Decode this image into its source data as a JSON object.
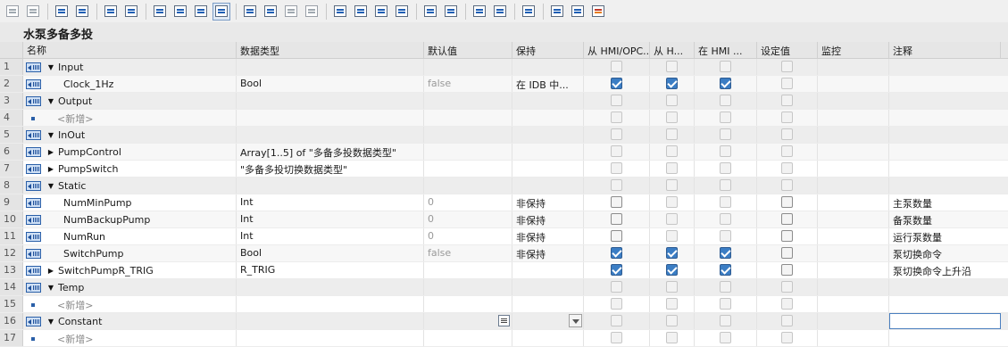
{
  "toolbar": {
    "buttons": [
      "insert-row-icon",
      "add-row-icon",
      "expand-icon",
      "download-icon",
      "compare-icon",
      "monitor-all-icon",
      "collapse-icon",
      "list-icon",
      "download-arrow-icon",
      "settings-selected-icon",
      "insert-var-icon",
      "delete-var-icon",
      "network-icon",
      "list-down-icon",
      "arrow-left-icon",
      "indent-icon",
      "outdent-icon",
      "align-icon",
      "branch-icon",
      "filter-icon",
      "undo-icon",
      "redo-icon",
      "lock-icon",
      "play-icon",
      "play-alt-icon",
      "stop-icon"
    ]
  },
  "block": {
    "title": "水泵多备多投"
  },
  "columns": {
    "name": "名称",
    "type": "数据类型",
    "default": "默认值",
    "retain": "保持",
    "hmi_opc": "从 HMI/OPC...",
    "from_h": "从 H...",
    "in_hmi": "在 HMI ...",
    "setpoint": "设定值",
    "monitor": "监控",
    "comment": "注释"
  },
  "rows": [
    {
      "n": "1",
      "name": "Input",
      "indent": 0,
      "expand": "down",
      "icon": "if",
      "type": "",
      "def": "",
      "ret": "",
      "hmi": "dis",
      "from": "dis",
      "in": "dis",
      "set": "dis",
      "cmt": ""
    },
    {
      "n": "2",
      "name": "Clock_1Hz",
      "indent": 1,
      "expand": "none",
      "icon": "if",
      "type": "Bool",
      "def": "false",
      "ret": "在 IDB 中...",
      "hmi": "chk",
      "from": "chk",
      "in": "chk",
      "set": "dis",
      "cmt": ""
    },
    {
      "n": "3",
      "name": "Output",
      "indent": 0,
      "expand": "down",
      "icon": "if",
      "type": "",
      "def": "",
      "ret": "",
      "hmi": "dis",
      "from": "dis",
      "in": "dis",
      "set": "dis",
      "cmt": ""
    },
    {
      "n": "4",
      "name": "<新增>",
      "indent": 1,
      "expand": "none",
      "icon": "sq",
      "type": "",
      "def": "",
      "ret": "",
      "hmi": "dis",
      "from": "dis",
      "in": "dis",
      "set": "dis",
      "cmt": "",
      "add": true
    },
    {
      "n": "5",
      "name": "InOut",
      "indent": 0,
      "expand": "down",
      "icon": "if",
      "type": "",
      "def": "",
      "ret": "",
      "hmi": "dis",
      "from": "dis",
      "in": "dis",
      "set": "dis",
      "cmt": ""
    },
    {
      "n": "6",
      "name": "PumpControl",
      "indent": 0,
      "expand": "right",
      "icon": "if",
      "type": "Array[1..5] of \"多备多投数据类型\"",
      "def": "",
      "ret": "",
      "hmi": "dis",
      "from": "dis",
      "in": "dis",
      "set": "dis",
      "cmt": ""
    },
    {
      "n": "7",
      "name": "PumpSwitch",
      "indent": 0,
      "expand": "right",
      "icon": "if",
      "type": "\"多备多投切换数据类型\"",
      "def": "",
      "ret": "",
      "hmi": "dis",
      "from": "dis",
      "in": "dis",
      "set": "dis",
      "cmt": ""
    },
    {
      "n": "8",
      "name": "Static",
      "indent": 0,
      "expand": "down",
      "icon": "if",
      "type": "",
      "def": "",
      "ret": "",
      "hmi": "dis",
      "from": "dis",
      "in": "dis",
      "set": "dis",
      "cmt": ""
    },
    {
      "n": "9",
      "name": "NumMinPump",
      "indent": 1,
      "expand": "none",
      "icon": "if",
      "type": "Int",
      "def": "0",
      "ret": "非保持",
      "hmi": "en",
      "from": "dis",
      "in": "dis",
      "set": "en",
      "cmt": "主泵数量"
    },
    {
      "n": "10",
      "name": "NumBackupPump",
      "indent": 1,
      "expand": "none",
      "icon": "if",
      "type": "Int",
      "def": "0",
      "ret": "非保持",
      "hmi": "en",
      "from": "dis",
      "in": "dis",
      "set": "en",
      "cmt": "备泵数量"
    },
    {
      "n": "11",
      "name": "NumRun",
      "indent": 1,
      "expand": "none",
      "icon": "if",
      "type": "Int",
      "def": "0",
      "ret": "非保持",
      "hmi": "en",
      "from": "dis",
      "in": "dis",
      "set": "en",
      "cmt": "运行泵数量"
    },
    {
      "n": "12",
      "name": "SwitchPump",
      "indent": 1,
      "expand": "none",
      "icon": "if",
      "type": "Bool",
      "def": "false",
      "ret": "非保持",
      "hmi": "chk",
      "from": "chk",
      "in": "chk",
      "set": "en",
      "cmt": "泵切换命令"
    },
    {
      "n": "13",
      "name": "SwitchPumpR_TRIG",
      "indent": 0,
      "expand": "right",
      "icon": "if",
      "type": "R_TRIG",
      "def": "",
      "ret": "",
      "hmi": "chk",
      "from": "chk",
      "in": "chk",
      "set": "en",
      "cmt": "泵切换命令上升沿"
    },
    {
      "n": "14",
      "name": "Temp",
      "indent": 0,
      "expand": "down",
      "icon": "if",
      "type": "",
      "def": "",
      "ret": "",
      "hmi": "dis",
      "from": "dis",
      "in": "dis",
      "set": "dis",
      "cmt": ""
    },
    {
      "n": "15",
      "name": "<新增>",
      "indent": 1,
      "expand": "none",
      "icon": "sq",
      "type": "",
      "def": "",
      "ret": "",
      "hmi": "dis",
      "from": "dis",
      "in": "dis",
      "set": "dis",
      "cmt": "",
      "add": true
    },
    {
      "n": "16",
      "name": "Constant",
      "indent": 0,
      "expand": "down",
      "icon": "if",
      "type": "",
      "def": "",
      "ret": "",
      "hmi": "dis",
      "from": "dis",
      "in": "dis",
      "set": "dis",
      "cmt": "",
      "active": true
    },
    {
      "n": "17",
      "name": "<新增>",
      "indent": 1,
      "expand": "none",
      "icon": "sq",
      "type": "",
      "def": "",
      "ret": "",
      "hmi": "dis",
      "from": "dis",
      "in": "dis",
      "set": "dis",
      "cmt": "",
      "add": true
    }
  ]
}
